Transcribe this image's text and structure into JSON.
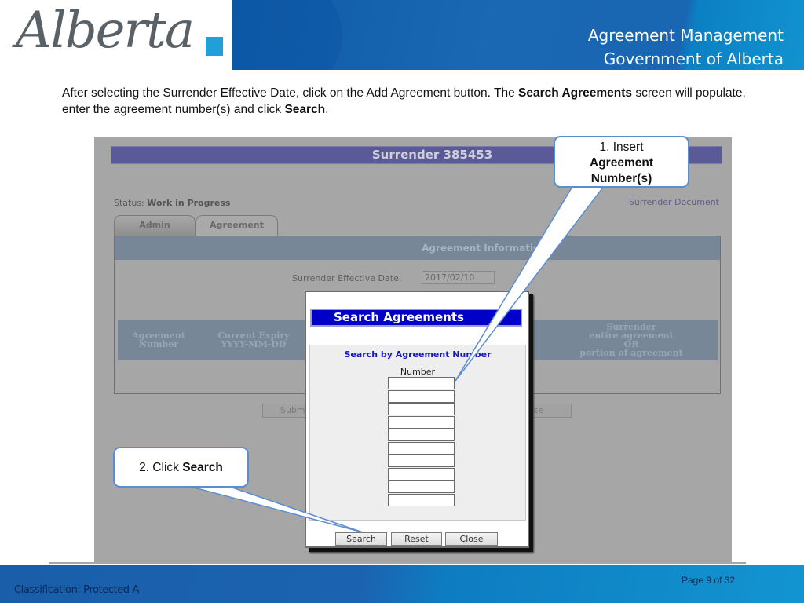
{
  "header": {
    "logo_text": "Alberta",
    "title_line1": "Agreement Management",
    "title_line2": "Government of Alberta",
    "brand_color": "#1966b2",
    "logo_accent": "#20a0d6"
  },
  "instructions": {
    "part1": "After selecting the Surrender Effective Date, click on the Add Agreement button.  The ",
    "bold1": "Search Agreements",
    "part2": " screen will populate, enter the agreement number(s) and click ",
    "bold2": "Search",
    "part3": "."
  },
  "screen": {
    "title": "Surrender 385453",
    "status_label": "Status:",
    "status_value": "Work in Progress",
    "surrender_document_link": "Surrender Document",
    "tabs": [
      {
        "label": "Admin"
      },
      {
        "label": "Agreement",
        "active": true
      }
    ],
    "panel_title": "Agreement Information",
    "date_label": "Surrender Effective Date:",
    "date_value": "2017/02/10",
    "table_headers": [
      {
        "line1": "Agreement",
        "line2": "Number"
      },
      {
        "line1": "Current Expiry",
        "line2": "YYYY-MM-DD"
      },
      {
        "line1": "Surrender",
        "line2": "entire agreement",
        "line3": "OR",
        "line4": "portion of agreement"
      }
    ],
    "bottom_buttons": {
      "submit": "Subm",
      "close": "ose"
    }
  },
  "modal": {
    "title": "Search Agreements",
    "subtitle": "Search by Agreement Number",
    "number_label": "Number",
    "number_fields": [
      "",
      "",
      "",
      "",
      "",
      "",
      "",
      "",
      "",
      ""
    ],
    "buttons": {
      "search": "Search",
      "reset": "Reset",
      "close": "Close"
    }
  },
  "callouts": {
    "c1_line1": "1. Insert",
    "c1_line2": "Agreement",
    "c1_line3": "Number(s)",
    "c2_text": "2. Click ",
    "c2_bold": "Search",
    "border_color": "#5b8dd3"
  },
  "footer": {
    "classification": "Classification: Protected A",
    "page": "Page 9 of 32"
  }
}
